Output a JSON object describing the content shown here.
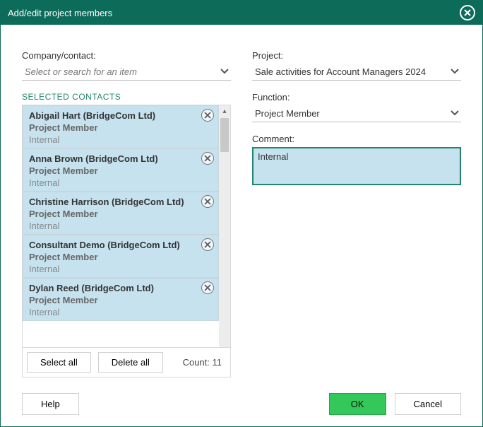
{
  "title": "Add/edit project members",
  "left": {
    "company_label": "Company/contact:",
    "company_placeholder": "Select or search for an item",
    "selected_contacts_label": "SELECTED CONTACTS",
    "contacts": [
      {
        "name": "Abigail Hart (BridgeCom Ltd)",
        "role": "Project Member",
        "note": "Internal"
      },
      {
        "name": "Anna Brown (BridgeCom Ltd)",
        "role": "Project Member",
        "note": "Internal"
      },
      {
        "name": "Christine Harrison (BridgeCom Ltd)",
        "role": "Project Member",
        "note": "Internal"
      },
      {
        "name": "Consultant Demo (BridgeCom Ltd)",
        "role": "Project Member",
        "note": "Internal"
      },
      {
        "name": "Dylan Reed (BridgeCom Ltd)",
        "role": "Project Member",
        "note": "Internal"
      }
    ],
    "select_all": "Select all",
    "delete_all": "Delete all",
    "count_label": "Count: 11"
  },
  "right": {
    "project_label": "Project:",
    "project_value": "Sale activities for Account Managers 2024",
    "function_label": "Function:",
    "function_value": "Project Member",
    "comment_label": "Comment:",
    "comment_value": "Internal"
  },
  "footer": {
    "help": "Help",
    "ok": "OK",
    "cancel": "Cancel"
  }
}
